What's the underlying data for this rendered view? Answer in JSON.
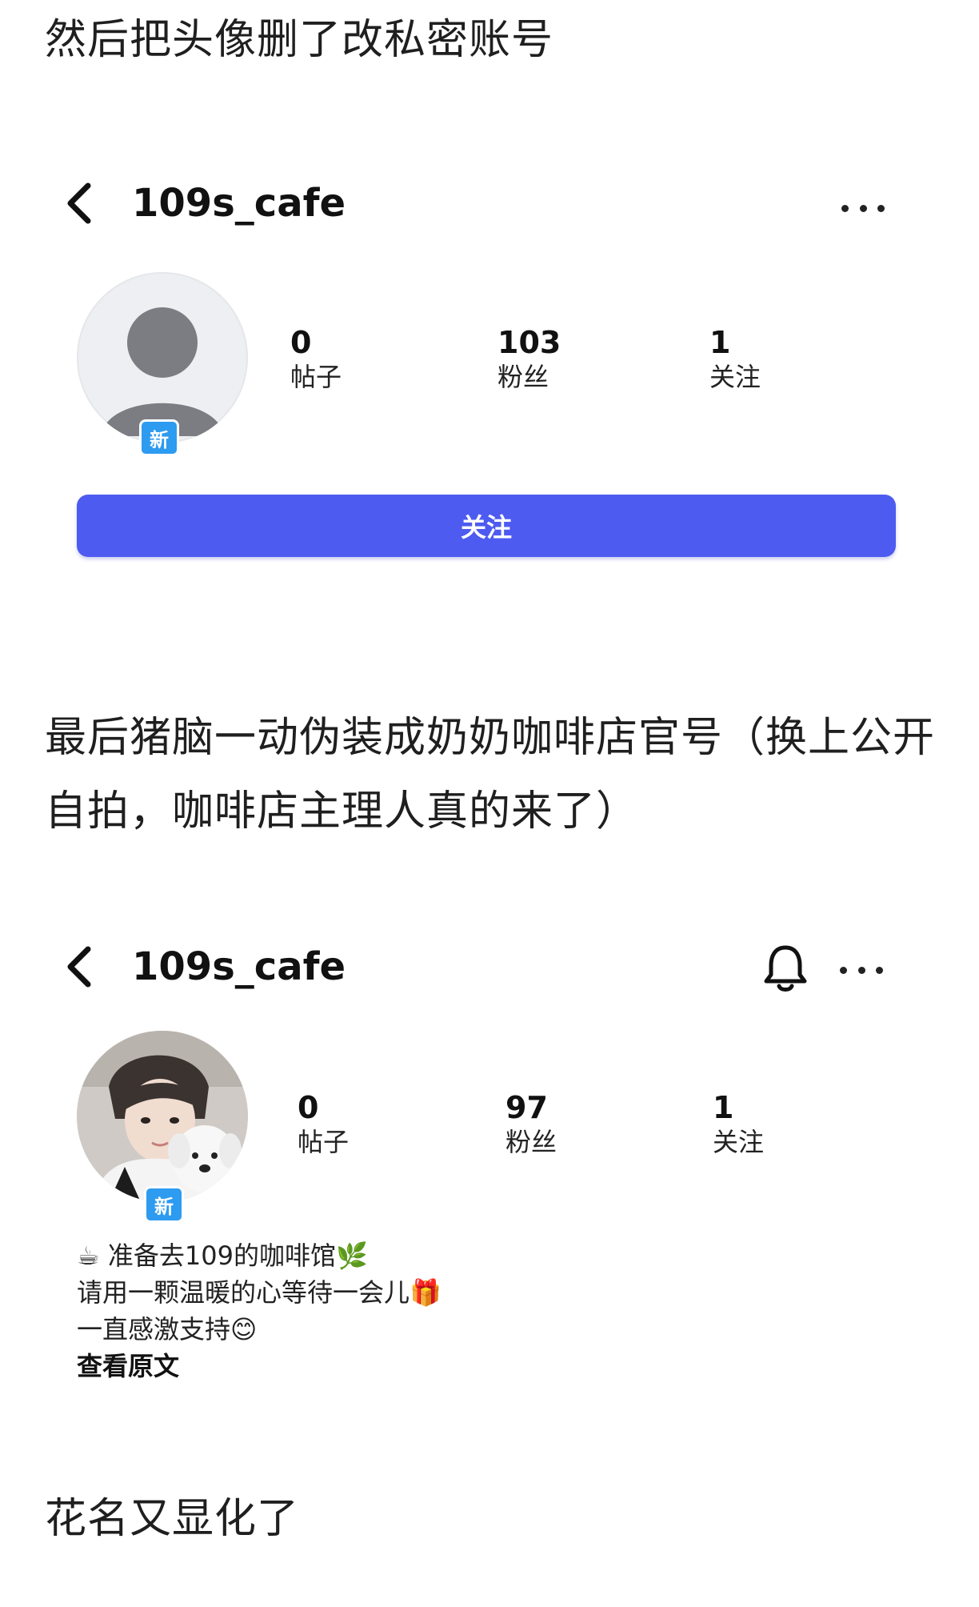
{
  "captions": {
    "first": "然后把头像删了改私密账号",
    "second": "最后猪脑一动伪装成奶奶咖啡店官号（换上公开自拍，咖啡店主理人真的来了）",
    "third": "花名又显化了"
  },
  "profile_private": {
    "username": "109s_cafe",
    "badge": "新",
    "stats": [
      {
        "value": "0",
        "label": "帖子"
      },
      {
        "value": "103",
        "label": "粉丝"
      },
      {
        "value": "1",
        "label": "关注"
      }
    ],
    "follow_button": "关注",
    "icons": [
      "back-chevron-icon",
      "more-dots-icon",
      "default-avatar-icon"
    ]
  },
  "profile_public": {
    "username": "109s_cafe",
    "badge": "新",
    "stats": [
      {
        "value": "0",
        "label": "帖子"
      },
      {
        "value": "97",
        "label": "粉丝"
      },
      {
        "value": "1",
        "label": "关注"
      }
    ],
    "bio": [
      {
        "emoji": "☕",
        "text": " 准备去109的咖啡馆",
        "trail": "🌿"
      },
      {
        "emoji": "",
        "text": "请用一颗温暖的心等待一会儿",
        "trail": "🎁"
      },
      {
        "emoji": "",
        "text": "一直感激支持",
        "trail": "😊"
      }
    ],
    "see_original": "查看原文",
    "icons": [
      "back-chevron-icon",
      "bell-icon",
      "more-dots-icon"
    ]
  }
}
